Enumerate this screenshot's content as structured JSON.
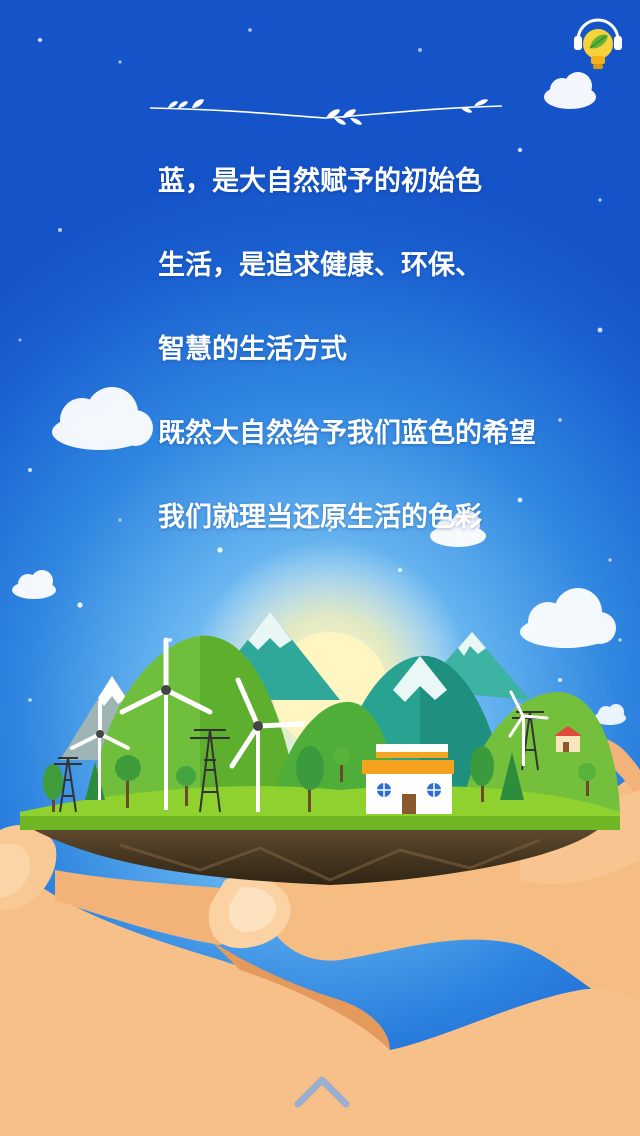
{
  "poem": {
    "lines": [
      "蓝，是大自然赋予的初始色",
      "生活，是追求健康、环保、",
      "智慧的生活方式",
      "既然大自然给予我们蓝色的希望",
      "我们就理当还原生活的色彩"
    ]
  },
  "icons": {
    "music": "lightbulb-music-icon",
    "next": "chevron-up-icon"
  },
  "colors": {
    "sky_deep": "#1553c8",
    "sky_glow": "#bfe8ff",
    "grass": "#7cc62c",
    "hand": "#f5b97f",
    "house_roof": "#f6a623"
  }
}
